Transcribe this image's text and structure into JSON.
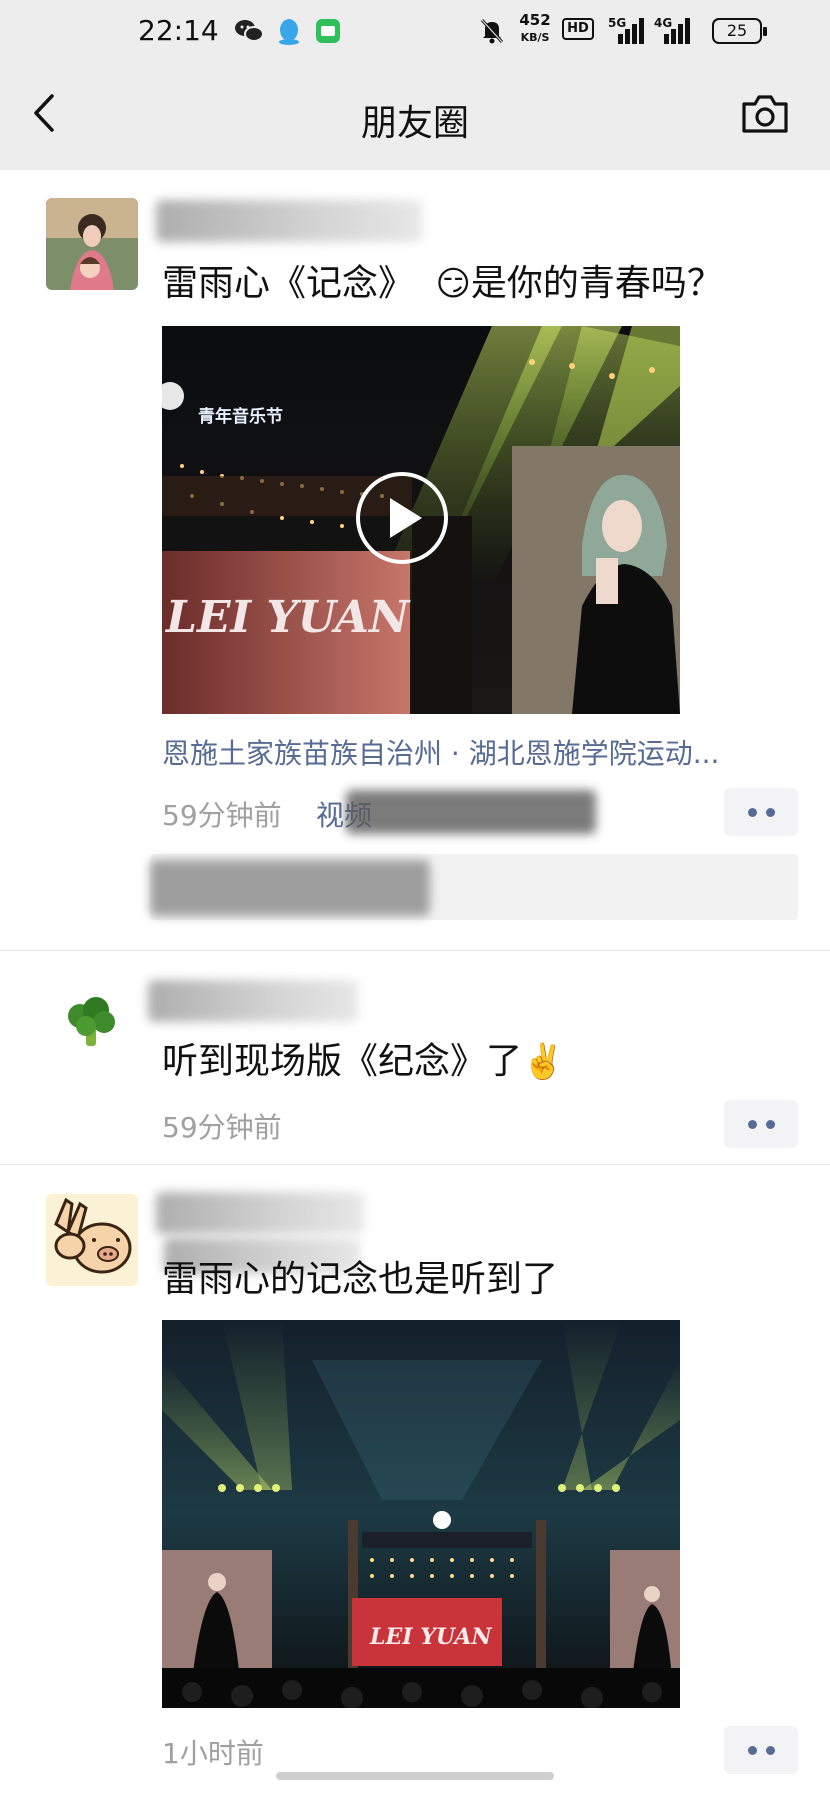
{
  "status_bar": {
    "time": "22:14",
    "net_speed_value": "452",
    "net_speed_unit": "KB/S",
    "hd_label": "HD",
    "signal_1_label": "5G",
    "signal_2_label": "4G",
    "battery": "25",
    "icons": [
      "wechat-icon",
      "qq-icon",
      "message-icon",
      "mute-bell-icon"
    ]
  },
  "header": {
    "title": "朋友圈",
    "back_icon": "chevron-left-icon",
    "camera_icon": "camera-icon"
  },
  "posts": [
    {
      "text_before_emoji": "雷雨心《记念》",
      "emoji": "😏",
      "text_after_emoji": "是你的青春吗？",
      "media_type": "video",
      "media_overlay_texts": [
        "青年音乐节",
        "LEI YUAN"
      ],
      "location": "恩施土家族苗族自治州 · 湖北恩施学院运动...",
      "time": "59分钟前",
      "source_partial": "视频"
    },
    {
      "text": "听到现场版《纪念》了",
      "emoji": "✌️",
      "time": "59分钟前"
    },
    {
      "text": "雷雨心的记念也是听到了",
      "media_type": "image",
      "media_overlay_texts": [
        "LEI YUAN"
      ],
      "time": "1小时前"
    }
  ],
  "colors": {
    "link_blue": "#576b95",
    "meta_gray": "#a0a0a0",
    "header_bg": "#ededed"
  }
}
